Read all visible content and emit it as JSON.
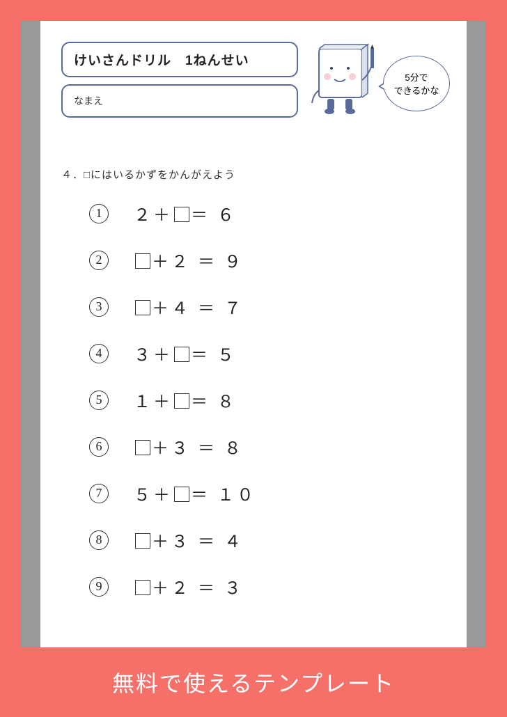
{
  "header": {
    "title": "けいさんドリル　1ねんせい",
    "name_label": "なまえ"
  },
  "bubble": {
    "line1": "5分で",
    "line2": "できるかな"
  },
  "instruction": "４．□にはいるかずをかんがえよう",
  "problems": [
    {
      "num": "1",
      "left": "２＋",
      "blank": true,
      "right": "＝ ６"
    },
    {
      "num": "2",
      "left": "",
      "blank": true,
      "right": "＋２ ＝ ９"
    },
    {
      "num": "3",
      "left": "",
      "blank": true,
      "right": "＋４ ＝ ７"
    },
    {
      "num": "4",
      "left": "３＋",
      "blank": true,
      "right": "＝ ５"
    },
    {
      "num": "5",
      "left": "１＋",
      "blank": true,
      "right": "＝ ８"
    },
    {
      "num": "6",
      "left": "",
      "blank": true,
      "right": "＋３ ＝ ８"
    },
    {
      "num": "7",
      "left": "５＋",
      "blank": true,
      "right": "＝ １０"
    },
    {
      "num": "8",
      "left": "",
      "blank": true,
      "right": "＋３ ＝ ４"
    },
    {
      "num": "9",
      "left": "",
      "blank": true,
      "right": "＋２ ＝ ３"
    }
  ],
  "banner": "無料で使えるテンプレート"
}
